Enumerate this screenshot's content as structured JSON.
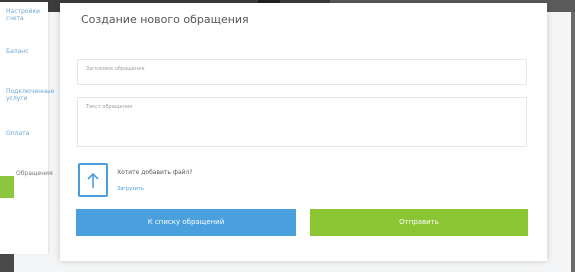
{
  "sidebar": {
    "items": [
      {
        "label": "Настройки счета"
      },
      {
        "label": "Баланс"
      },
      {
        "label": "Подключенные услуги"
      },
      {
        "label": "Оплата"
      },
      {
        "label": "Обращения"
      }
    ]
  },
  "dialog": {
    "title": "Создание нового обращения",
    "subject_placeholder": "Заголовок обращения",
    "body_placeholder": "Текст обращения",
    "upload_question": "Хотите добавить файл?",
    "upload_link": "Загрузить",
    "back_button": "К списку обращений",
    "send_button": "Отправить"
  },
  "colors": {
    "accent_blue": "#4a9fdd",
    "accent_green": "#8bc534"
  },
  "icons": {
    "upload": "upload-arrow-icon"
  }
}
